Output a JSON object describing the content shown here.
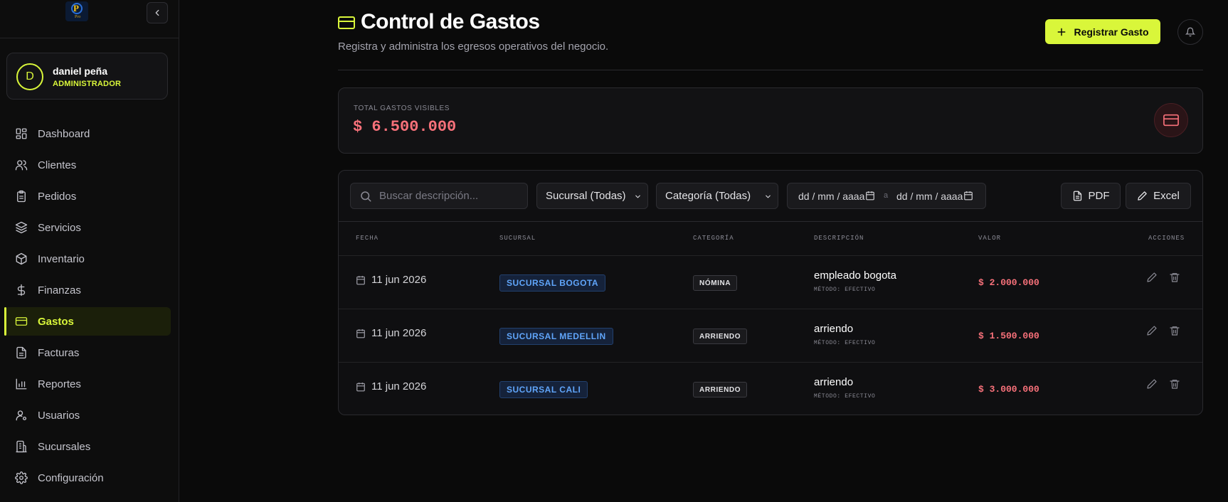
{
  "sidebar": {
    "logo_text": "Pro",
    "user": {
      "initial": "D",
      "name": "daniel peña",
      "role": "ADMINISTRADOR"
    },
    "items": [
      {
        "label": "Dashboard",
        "icon": "dashboard-icon"
      },
      {
        "label": "Clientes",
        "icon": "users-icon"
      },
      {
        "label": "Pedidos",
        "icon": "clipboard-icon"
      },
      {
        "label": "Servicios",
        "icon": "layers-icon"
      },
      {
        "label": "Inventario",
        "icon": "box-icon"
      },
      {
        "label": "Finanzas",
        "icon": "dollar-icon"
      },
      {
        "label": "Gastos",
        "icon": "credit-card-icon",
        "active": true
      },
      {
        "label": "Facturas",
        "icon": "file-icon"
      },
      {
        "label": "Reportes",
        "icon": "bar-chart-icon"
      },
      {
        "label": "Usuarios",
        "icon": "user-cog-icon"
      },
      {
        "label": "Sucursales",
        "icon": "building-icon"
      },
      {
        "label": "Configuración",
        "icon": "gear-icon"
      }
    ]
  },
  "header": {
    "title": "Control de Gastos",
    "subtitle": "Registra y administra los egresos operativos del negocio.",
    "register_label": "Registrar Gasto"
  },
  "summary": {
    "label": "TOTAL GASTOS VISIBLES",
    "value": "$ 6.500.000"
  },
  "filters": {
    "search_placeholder": "Buscar descripción...",
    "branch_select": "Sucursal (Todas)",
    "category_select": "Categoría (Todas)",
    "date_from": "dd / mm / aaaa",
    "date_sep": "a",
    "date_to": "dd / mm / aaaa",
    "pdf_label": "PDF",
    "excel_label": "Excel"
  },
  "table": {
    "headers": [
      "FECHA",
      "SUCURSAL",
      "CATEGORÍA",
      "DESCRIPCIÓN",
      "VALOR",
      "ACCIONES"
    ],
    "rows": [
      {
        "date": "11 jun 2026",
        "branch": "SUCURSAL BOGOTA",
        "category": "NÓMINA",
        "description": "empleado bogota",
        "method": "MÉTODO: EFECTIVO",
        "value": "$ 2.000.000"
      },
      {
        "date": "11 jun 2026",
        "branch": "SUCURSAL MEDELLIN",
        "category": "ARRIENDO",
        "description": "arriendo",
        "method": "MÉTODO: EFECTIVO",
        "value": "$ 1.500.000"
      },
      {
        "date": "11 jun 2026",
        "branch": "SUCURSAL CALI",
        "category": "ARRIENDO",
        "description": "arriendo",
        "method": "MÉTODO: EFECTIVO",
        "value": "$ 3.000.000"
      }
    ]
  },
  "colors": {
    "accent": "#d9f63a",
    "expense_red": "#f8717a",
    "branch_blue": "#60a5fa",
    "background": "#0a0a0a"
  }
}
